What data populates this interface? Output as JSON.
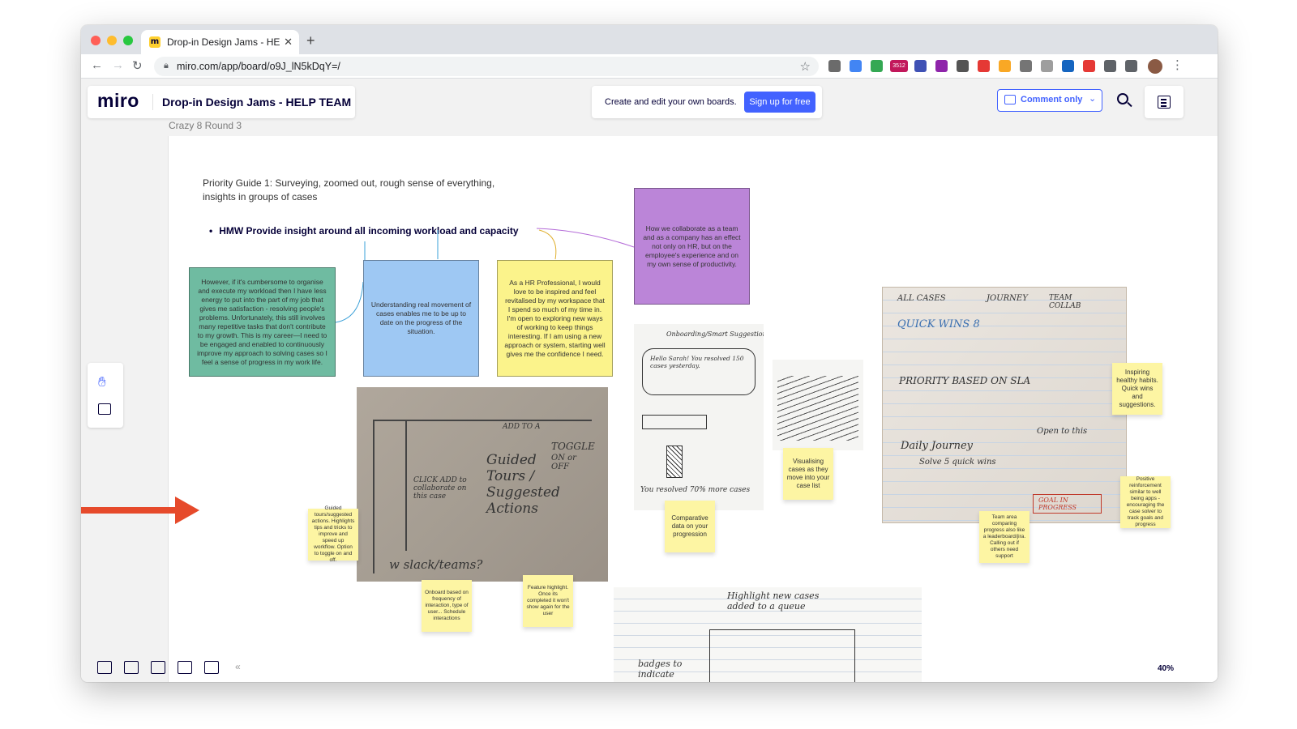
{
  "browser": {
    "tab_title": "Drop-in Design Jams - HELP T",
    "tab_close": "✕",
    "new_tab": "+",
    "url": "miro.com/app/board/o9J_lN5kDqY=/",
    "ext_badge": "3512"
  },
  "header": {
    "logo": "miro",
    "board_title": "Drop-in Design Jams - HELP TEAM",
    "signup_prompt": "Create and edit your own boards.",
    "signup_button": "Sign up for free",
    "comment_mode": "Comment only",
    "comment_chevron": "⌄"
  },
  "frame": {
    "label": "Crazy 8 Round 3"
  },
  "canvas": {
    "guide_text": "Priority Guide 1: Surveying, zoomed out, rough sense of everything, insights in groups of cases",
    "hmw": "HMW Provide insight around all incoming workload and capacity",
    "cards": {
      "green": "However, if it's cumbersome to organise and execute my workload then I have less energy to put into the part of my job that gives me satisfaction - resolving people's problems. Unfortunately, this still involves many repetitive tasks that don't contribute to my growth. This is my career—I need to be engaged and enabled to continuously improve my approach to solving cases so I feel a sense of progress in my work life.",
      "blue": "Understanding real movement of cases enables me to be up to date on the progress of the situation.",
      "yellow": "As a HR Professional, I would love to be inspired and feel revitalised by my workspace that I spend so much of my time in. I'm open to exploring new ways of working to keep things interesting. If I am using a new approach or system, starting well gives me the confidence I need.",
      "purple": "How we collaborate as a team and as a company has an effect not only on HR, but on the employee's experience and on my own sense of productivity."
    },
    "stickies": {
      "guided": "Guided tours/suggested actions. Highlights tips and tricks to improve and speed up workflow. Option to toggle on and off.",
      "onboard": "Onboard based on frequency of interaction, type of user... Schedule interactions",
      "feature": "Feature highlight. Once its completed it won't show again for the user",
      "comparative": "Comparative data on your progression",
      "visualising": "Visualising cases as they move into your case list",
      "inspiring": "Inspiring healthy habits. Quick wins and suggestions.",
      "team_area": "Team area comparing progress also like a leaderboard/jira. Calling out if others need support",
      "positive": "Positive reinforcement similar to well being apps - encouraging the case solver to track goals and progress"
    },
    "sketch_text": {
      "s1_guided": "Guided",
      "s1_tours": "Tours /",
      "s1_suggested": "Suggested",
      "s1_actions": "Actions",
      "s1_toggle": "TOGGLE",
      "s1_on_or_off": "ON or OFF",
      "s1_slack": "w slack/teams?",
      "s1_click": "CLICK ADD to collaborate on this case",
      "s1_add_to": "ADD TO A",
      "s2_title": "Onboarding/Smart Suggestions",
      "s2_hello": "Hello Sarah! You resolved 150 cases yesterday.",
      "s2_resolved": "You resolved 70% more cases",
      "s4_all_cases": "ALL CASES",
      "s4_journey": "JOURNEY",
      "s4_team": "TEAM COLLAB",
      "s4_quick_wins": "QUICK WINS 8",
      "s4_priority": "PRIORITY BASED ON SLA",
      "s4_daily": "Daily Journey",
      "s4_solve": "Solve 5 quick wins",
      "s4_open": "Open to this",
      "s4_goal": "GOAL IN PROGRESS",
      "s5_highlight": "Highlight new cases added to a queue",
      "s5_badges": "badges to indicate"
    },
    "zoom": "40%"
  },
  "colors": {
    "miro_blue": "#4262ff",
    "miro_navy": "#050038",
    "arrow": "#e64a2b",
    "card_green": "#6fbba1",
    "card_blue": "#9ec8f3",
    "card_yellow": "#fbf38b",
    "card_purple": "#bb85d8",
    "sticky": "#fdf5a3"
  },
  "icons": {
    "hand_tool": "hand-icon",
    "comment_tool": "comment-icon",
    "frames": "frames-icon",
    "present": "present-icon",
    "comments": "comments-icon",
    "cards": "cards-icon",
    "grid": "grid-icon",
    "collapse": "«"
  }
}
